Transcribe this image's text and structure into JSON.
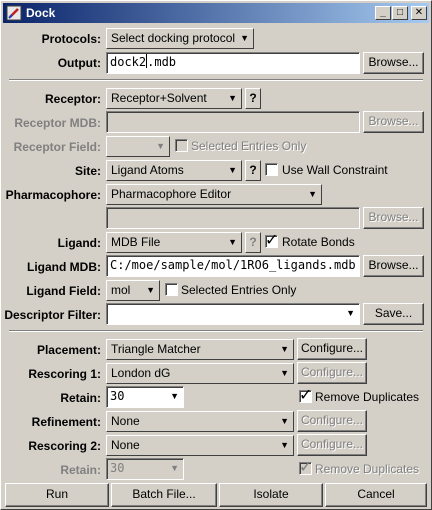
{
  "window": {
    "title": "Dock",
    "controls": {
      "minimize": "_",
      "maximize": "□",
      "close": "✕"
    }
  },
  "protocols": {
    "label": "Protocols:",
    "value": "Select docking protocol"
  },
  "output": {
    "label": "Output:",
    "value_before": "dock2",
    "value_after": ".mdb",
    "browse": "Browse..."
  },
  "receptor": {
    "label": "Receptor:",
    "value": "Receptor+Solvent",
    "help": "?"
  },
  "receptor_mdb": {
    "label": "Receptor MDB:",
    "value": "",
    "browse": "Browse..."
  },
  "receptor_field": {
    "label": "Receptor Field:",
    "value": "",
    "selected_only": "Selected Entries Only"
  },
  "site": {
    "label": "Site:",
    "value": "Ligand Atoms",
    "help": "?",
    "wall": "Use Wall Constraint"
  },
  "pharmacophore": {
    "label": "Pharmacophore:",
    "value": "Pharmacophore Editor",
    "file": "",
    "browse": "Browse..."
  },
  "ligand": {
    "label": "Ligand:",
    "value": "MDB File",
    "help": "?",
    "rotate": "Rotate Bonds"
  },
  "ligand_mdb": {
    "label": "Ligand MDB:",
    "value": "C:/moe/sample/mol/1RO6_ligands.mdb",
    "browse": "Browse..."
  },
  "ligand_field": {
    "label": "Ligand Field:",
    "value": "mol",
    "selected_only": "Selected Entries Only"
  },
  "descriptor_filter": {
    "label": "Descriptor Filter:",
    "value": "",
    "save": "Save..."
  },
  "placement": {
    "label": "Placement:",
    "value": "Triangle Matcher",
    "configure": "Configure..."
  },
  "rescoring1": {
    "label": "Rescoring 1:",
    "value": "London dG",
    "configure": "Configure..."
  },
  "retain1": {
    "label": "Retain:",
    "value": "30",
    "dedupe": "Remove Duplicates"
  },
  "refinement": {
    "label": "Refinement:",
    "value": "None",
    "configure": "Configure..."
  },
  "rescoring2": {
    "label": "Rescoring 2:",
    "value": "None",
    "configure": "Configure..."
  },
  "retain2": {
    "label": "Retain:",
    "value": "30",
    "dedupe": "Remove Duplicates"
  },
  "buttons": {
    "run": "Run",
    "batch": "Batch File...",
    "isolate": "Isolate",
    "cancel": "Cancel"
  },
  "glyphs": {
    "arrow": "▼",
    "check": "✓"
  }
}
